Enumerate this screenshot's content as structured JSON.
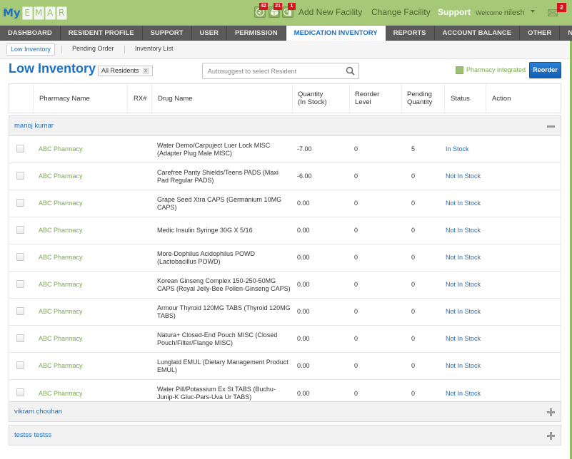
{
  "header": {
    "logo_prefix": "My",
    "logo_letters": [
      "E",
      "M",
      "A",
      "R"
    ],
    "notifications": [
      {
        "icon": "runner-icon",
        "count": "42"
      },
      {
        "icon": "box-icon",
        "count": "21"
      },
      {
        "icon": "alert-document-icon",
        "count": "1"
      }
    ],
    "add_facility": "Add New Facility",
    "change_facility": "Change Facility",
    "support": "Support",
    "welcome_prefix": "Welcome",
    "username": "nilesh",
    "mail_count": "2"
  },
  "main_nav": {
    "tabs": [
      {
        "label": "DASHBOARD",
        "active": false
      },
      {
        "label": "RESIDENT PROFILE",
        "active": false
      },
      {
        "label": "SUPPORT",
        "active": false
      },
      {
        "label": "USER",
        "active": false
      },
      {
        "label": "PERMISSION",
        "active": false
      },
      {
        "label": "MEDICATION INVENTORY",
        "active": true
      },
      {
        "label": "REPORTS",
        "active": false
      },
      {
        "label": "ACCOUNT BALANCE",
        "active": false
      },
      {
        "label": "OTHER",
        "active": false
      },
      {
        "label": "Notes",
        "active": false
      }
    ]
  },
  "sub_nav": {
    "tabs": [
      {
        "label": "Low Inventory",
        "active": true
      },
      {
        "label": "Pending Order",
        "active": false
      },
      {
        "label": "Inventory List",
        "active": false
      }
    ]
  },
  "page": {
    "title": "Low Inventory",
    "filter_chip": "All Residents",
    "filter_chip_remove": "x",
    "search_placeholder": "Autosuggest to select Resident",
    "search_value": "",
    "legend_label": "Pharmacy integrated",
    "legend_color": "#9cbf73",
    "reorder_label": "Reorder"
  },
  "colors": {
    "topbar": "#a6c978",
    "accent_blue": "#1c6fc4",
    "pharmacy_green": "#7aa84d",
    "nav_dark": "#5a5a5a",
    "badge_red": "#d4151b"
  },
  "table": {
    "columns": [
      "",
      "Pharmacy Name",
      "RX#",
      "Drug Name",
      "Quantity (In Stock)",
      "Reorder Level",
      "Pending Quantity",
      "Status",
      "Action"
    ],
    "column_lines": {
      "qty": [
        "Quantity",
        "(In Stock)"
      ],
      "reorder": [
        "Reorder",
        "Level"
      ],
      "pending": [
        "Pending",
        "Quantity"
      ]
    },
    "groups": [
      {
        "name": "manoj kumar",
        "expanded": true,
        "toggle": "collapse",
        "rows": [
          {
            "pharmacy": "ABC Pharmacy",
            "rx": "",
            "drug": "Water Demo/Carpuject Luer Lock MISC (Adapter Plug Male MISC)",
            "qty": "-7.00",
            "reorder": "0",
            "pending": "5",
            "status": "In Stock",
            "action": ""
          },
          {
            "pharmacy": "ABC Pharmacy",
            "rx": "",
            "drug": "Carefree Panty Shields/Teens PADS (Maxi Pad Regular PADS)",
            "qty": "-6.00",
            "reorder": "0",
            "pending": "0",
            "status": "Not In Stock",
            "action": ""
          },
          {
            "pharmacy": "ABC Pharmacy",
            "rx": "",
            "drug": "Grape Seed Xtra CAPS (Germanium 10MG CAPS)",
            "qty": "0.00",
            "reorder": "0",
            "pending": "0",
            "status": "Not In Stock",
            "action": ""
          },
          {
            "pharmacy": "ABC Pharmacy",
            "rx": "",
            "drug": "Medic Insulin Syringe 30G X 5/16",
            "qty": "0.00",
            "reorder": "0",
            "pending": "0",
            "status": "Not In Stock",
            "action": ""
          },
          {
            "pharmacy": "ABC Pharmacy",
            "rx": "",
            "drug": "More-Dophilus Acidophilus POWD (Lactobacillus POWD)",
            "qty": "0.00",
            "reorder": "0",
            "pending": "0",
            "status": "Not In Stock",
            "action": ""
          },
          {
            "pharmacy": "ABC Pharmacy",
            "rx": "",
            "drug": "Korean Ginseng Complex 150-250-50MG CAPS (Royal Jelly-Bee Pollen-Ginseng CAPS)",
            "qty": "0.00",
            "reorder": "0",
            "pending": "0",
            "status": "Not In Stock",
            "action": ""
          },
          {
            "pharmacy": "ABC Pharmacy",
            "rx": "",
            "drug": "Armour Thyroid 120MG TABS (Thyroid 120MG TABS)",
            "qty": "0.00",
            "reorder": "0",
            "pending": "0",
            "status": "Not In Stock",
            "action": ""
          },
          {
            "pharmacy": "ABC Pharmacy",
            "rx": "",
            "drug": "Natura+ Closed-End Pouch MISC (Closed Pouch/Filter/Flange MISC)",
            "qty": "0.00",
            "reorder": "0",
            "pending": "0",
            "status": "Not In Stock",
            "action": ""
          },
          {
            "pharmacy": "ABC Pharmacy",
            "rx": "",
            "drug": "Lunglaid EMUL (Dietary Management Product EMUL)",
            "qty": "0.00",
            "reorder": "0",
            "pending": "0",
            "status": "Not In Stock",
            "action": ""
          },
          {
            "pharmacy": "ABC Pharmacy",
            "rx": "",
            "drug": "Water Pill/Potassium Ex St TABS (Buchu-Junip-K Gluc-Pars-Uva Ur TABS)",
            "qty": "0.00",
            "reorder": "0",
            "pending": "0",
            "status": "Not In Stock",
            "action": ""
          }
        ]
      },
      {
        "name": "vikram chouhan",
        "expanded": false,
        "toggle": "expand",
        "rows": []
      },
      {
        "name": "testss testss",
        "expanded": false,
        "toggle": "expand",
        "rows": []
      }
    ]
  }
}
